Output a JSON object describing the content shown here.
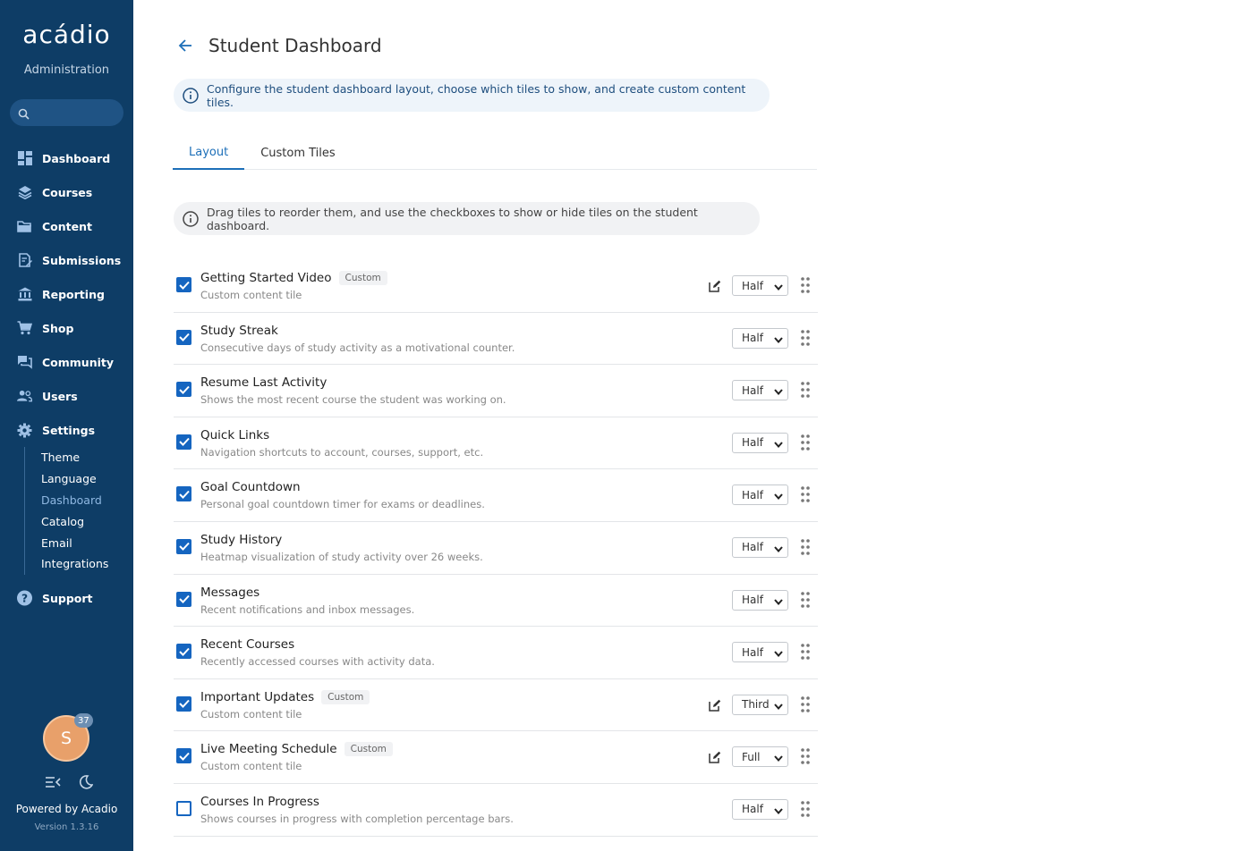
{
  "sidebar": {
    "brand": "acádio",
    "subtitle": "Administration",
    "nav": [
      {
        "label": "Dashboard",
        "icon": "dashboard-icon"
      },
      {
        "label": "Courses",
        "icon": "layers-icon"
      },
      {
        "label": "Content",
        "icon": "folder-icon"
      },
      {
        "label": "Submissions",
        "icon": "submission-icon"
      },
      {
        "label": "Reporting",
        "icon": "bank-icon"
      },
      {
        "label": "Shop",
        "icon": "cart-icon"
      },
      {
        "label": "Community",
        "icon": "chat-icon"
      },
      {
        "label": "Users",
        "icon": "users-icon"
      },
      {
        "label": "Settings",
        "icon": "gear-icon"
      }
    ],
    "settings_sub": [
      {
        "label": "Theme"
      },
      {
        "label": "Language"
      },
      {
        "label": "Dashboard"
      },
      {
        "label": "Catalog"
      },
      {
        "label": "Email"
      },
      {
        "label": "Integrations"
      }
    ],
    "support": "Support",
    "avatar_letter": "S",
    "notification_count": "37",
    "powered_by": "Powered by Acadio",
    "version": "Version 1.3.16"
  },
  "page": {
    "title": "Student Dashboard",
    "info": "Configure the student dashboard layout, choose which tiles to show, and create custom content tiles.",
    "tabs": [
      {
        "label": "Layout"
      },
      {
        "label": "Custom Tiles"
      }
    ],
    "hint": "Drag tiles to reorder them, and use the checkboxes to show or hide tiles on the student dashboard."
  },
  "tiles": [
    {
      "name": "Getting Started Video",
      "tag": "Custom",
      "desc": "Custom content tile",
      "size": "Half",
      "checked": true,
      "editable": true
    },
    {
      "name": "Study Streak",
      "tag": "",
      "desc": "Consecutive days of study activity as a motivational counter.",
      "size": "Half",
      "checked": true,
      "editable": false
    },
    {
      "name": "Resume Last Activity",
      "tag": "",
      "desc": "Shows the most recent course the student was working on.",
      "size": "Half",
      "checked": true,
      "editable": false
    },
    {
      "name": "Quick Links",
      "tag": "",
      "desc": "Navigation shortcuts to account, courses, support, etc.",
      "size": "Half",
      "checked": true,
      "editable": false
    },
    {
      "name": "Goal Countdown",
      "tag": "",
      "desc": "Personal goal countdown timer for exams or deadlines.",
      "size": "Half",
      "checked": true,
      "editable": false
    },
    {
      "name": "Study History",
      "tag": "",
      "desc": "Heatmap visualization of study activity over 26 weeks.",
      "size": "Half",
      "checked": true,
      "editable": false
    },
    {
      "name": "Messages",
      "tag": "",
      "desc": "Recent notifications and inbox messages.",
      "size": "Half",
      "checked": true,
      "editable": false
    },
    {
      "name": "Recent Courses",
      "tag": "",
      "desc": "Recently accessed courses with activity data.",
      "size": "Half",
      "checked": true,
      "editable": false
    },
    {
      "name": "Important Updates",
      "tag": "Custom",
      "desc": "Custom content tile",
      "size": "Third",
      "checked": true,
      "editable": true
    },
    {
      "name": "Live Meeting Schedule",
      "tag": "Custom",
      "desc": "Custom content tile",
      "size": "Full",
      "checked": true,
      "editable": true
    },
    {
      "name": "Courses In Progress",
      "tag": "",
      "desc": "Shows courses in progress with completion percentage bars.",
      "size": "Half",
      "checked": false,
      "editable": false
    }
  ],
  "colors": {
    "sidebar": "#0e3d66",
    "accent": "#1565c0"
  }
}
